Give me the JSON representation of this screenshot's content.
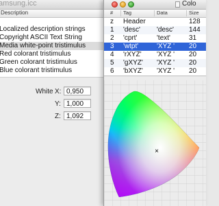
{
  "back_window": {
    "title": "amsung.icc",
    "column_header": "Description",
    "descriptions": [
      "Localized description strings",
      "Copyright ASCII Text String",
      "Media white-point tristimulus",
      "Red colorant tristimulus",
      "Green colorant tristimulus",
      "Blue colorant tristimulus"
    ],
    "selected_index": 2,
    "white_label": "White",
    "x_label": "X:",
    "y_label": "Y:",
    "z_label": "Z:",
    "x_value": "0,950",
    "y_value": "1,000",
    "z_value": "1,092"
  },
  "front_window": {
    "title": "Colo",
    "columns": [
      "#",
      "Tag",
      "Data",
      "Size"
    ],
    "rows": [
      {
        "num": "z",
        "tag": "Header",
        "data": "",
        "size": "128"
      },
      {
        "num": "1",
        "tag": "'desc'",
        "data": "'desc'",
        "size": "144"
      },
      {
        "num": "2",
        "tag": "'cprt'",
        "data": "'text'",
        "size": "31"
      },
      {
        "num": "3",
        "tag": "'wtpt'",
        "data": "'XYZ '",
        "size": "20"
      },
      {
        "num": "4",
        "tag": "'rXYZ'",
        "data": "'XYZ '",
        "size": "20"
      },
      {
        "num": "5",
        "tag": "'gXYZ'",
        "data": "'XYZ '",
        "size": "20"
      },
      {
        "num": "6",
        "tag": "'bXYZ'",
        "data": "'XYZ '",
        "size": "20"
      }
    ],
    "selected_row": 3,
    "selection_color": "#2f64d8",
    "white_point_marker": "×"
  }
}
